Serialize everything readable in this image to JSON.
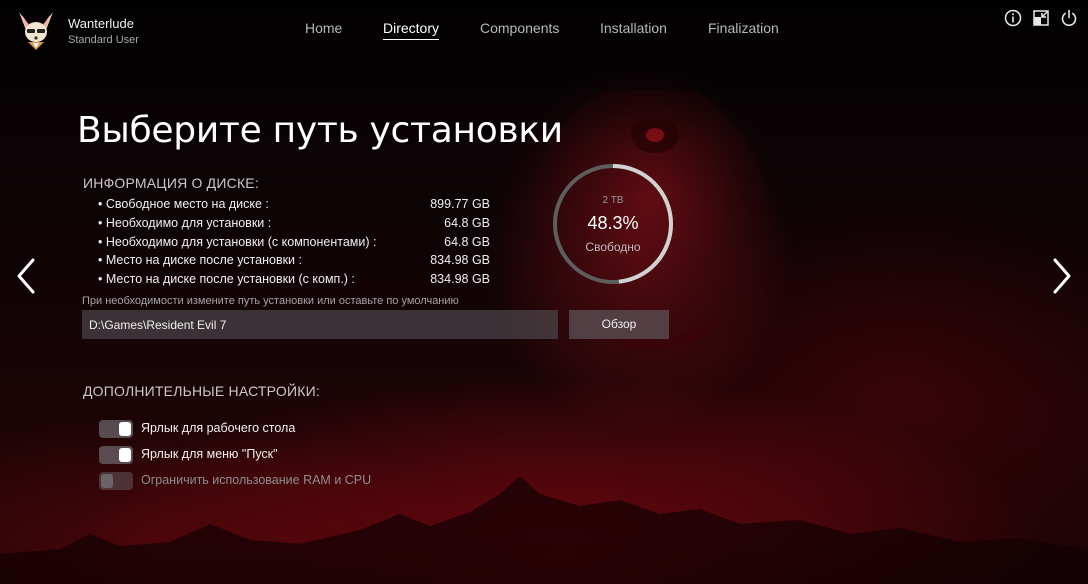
{
  "app": {
    "name": "Wanterlude",
    "user_role": "Standard User"
  },
  "nav": {
    "tabs": [
      {
        "label": "Home",
        "active": false
      },
      {
        "label": "Directory",
        "active": true
      },
      {
        "label": "Components",
        "active": false
      },
      {
        "label": "Installation",
        "active": false
      },
      {
        "label": "Finalization",
        "active": false
      }
    ]
  },
  "window_controls": [
    "info-icon",
    "minimize-to-tray-icon",
    "power-icon"
  ],
  "page": {
    "title": "Выберите путь установки",
    "disk_info_heading": "ИНФОРМАЦИЯ О ДИСКЕ:",
    "disk_info": [
      {
        "label": "• Свободное место на диске :",
        "value": "899.77 GB"
      },
      {
        "label": "• Необходимо для установки :",
        "value": "64.8 GB"
      },
      {
        "label": "• Необходимо для установки (с компонентами) :",
        "value": "64.8 GB"
      },
      {
        "label": "• Место на диске после установки :",
        "value": "834.98 GB"
      },
      {
        "label": "• Место на диске после установки (с комп.) :",
        "value": "834.98 GB"
      }
    ],
    "disk_ring": {
      "total": "2 TB",
      "percent_text": "48.3%",
      "percent_value": 48.3,
      "caption": "Свободно"
    },
    "path_hint": "При необходимости измените путь установки или оставьте по умолчанию",
    "path_value": "D:\\Games\\Resident Evil 7",
    "browse_label": "Обзор",
    "extra_heading": "ДОПОЛНИТЕЛЬНЫЕ НАСТРОЙКИ:",
    "options": [
      {
        "label": "Ярлык для рабочего стола",
        "checked": true,
        "enabled": true
      },
      {
        "label": "Ярлык для меню \"Пуск\"",
        "checked": true,
        "enabled": true
      },
      {
        "label": "Ограничить использование RAM и CPU",
        "checked": false,
        "enabled": false
      }
    ]
  },
  "colors": {
    "accent_red": "#8a0c14",
    "text_primary": "#ffffff",
    "ring_track": "#6b6b6b",
    "ring_fill": "#d0d0d0"
  }
}
